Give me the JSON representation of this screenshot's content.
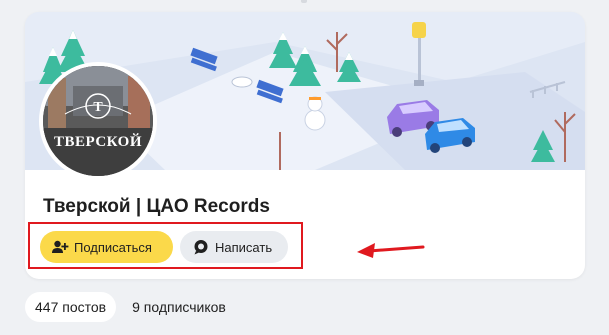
{
  "channel": {
    "name": "Тверской | ЦАО Records",
    "avatar_text": "ТВЕРСКОЙ"
  },
  "actions": {
    "subscribe_label": "Подписаться",
    "write_label": "Написать"
  },
  "stats": {
    "posts": "447 постов",
    "subscribers": "9 подписчиков"
  },
  "colors": {
    "subscribe_button": "#fbd94a",
    "write_button": "#e9ecf0",
    "highlight_frame": "#e0191f",
    "page_background": "#eff1f4"
  },
  "icons": {
    "subscribe": "person-plus-icon",
    "write": "chat-bubble-icon"
  }
}
